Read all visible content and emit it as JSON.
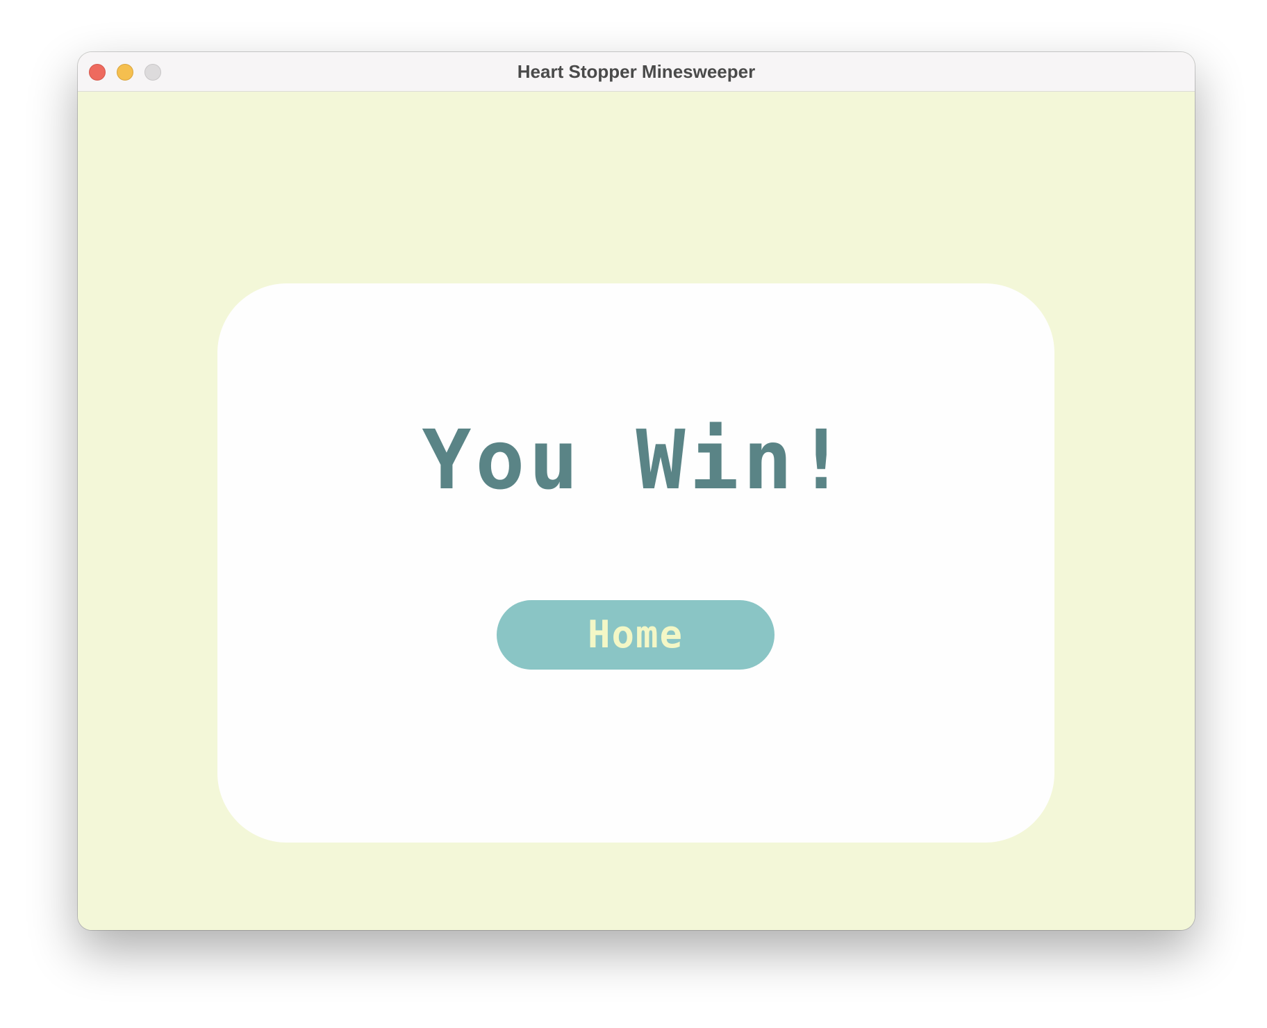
{
  "window": {
    "title": "Heart Stopper Minesweeper",
    "controls": {
      "close": "close-button",
      "minimize": "minimize-button",
      "zoom": "zoom-button"
    }
  },
  "dialog": {
    "message": "You Win!",
    "home_label": "Home"
  },
  "colors": {
    "background": "#f3f7d8",
    "card": "#fefefe",
    "message_text": "#5a8486",
    "button": "#8ac5c5",
    "button_text": "#f3f7c6"
  }
}
